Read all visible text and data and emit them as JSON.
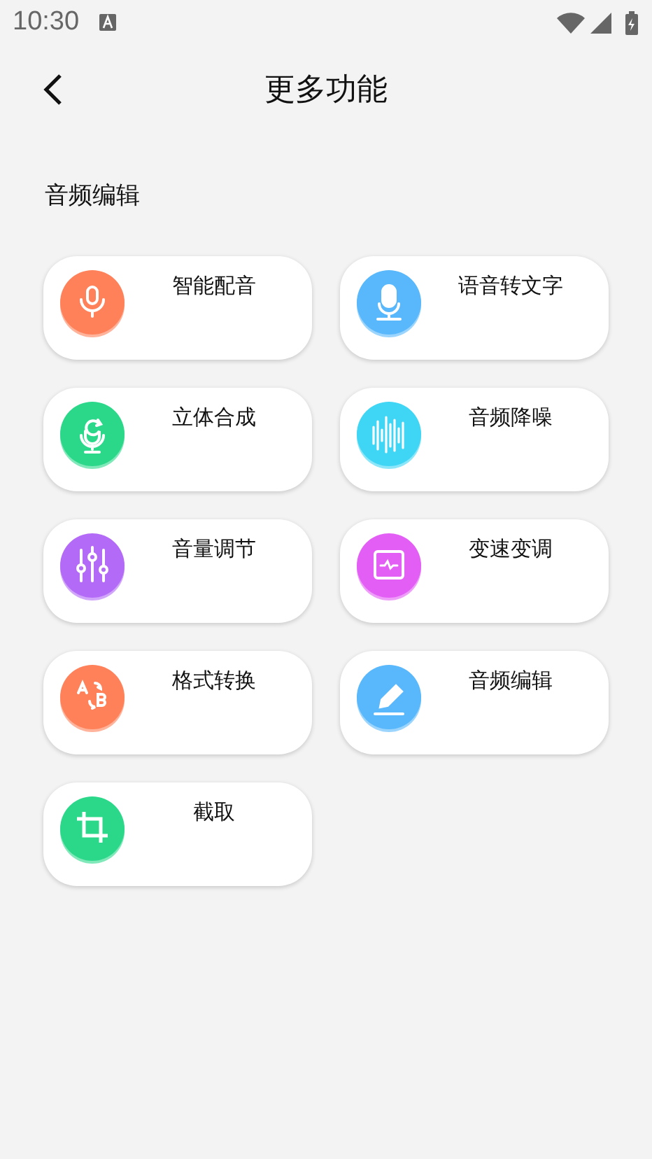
{
  "status_bar": {
    "time": "10:30"
  },
  "header": {
    "title": "更多功能"
  },
  "section": {
    "title": "音频编辑"
  },
  "features": [
    {
      "label": "智能配音",
      "kind": "mic",
      "color": "#ff8159"
    },
    {
      "label": "语音转文字",
      "kind": "mic-text",
      "color": "#58b8fb"
    },
    {
      "label": "立体合成",
      "kind": "mic-loop",
      "color": "#2bd88a"
    },
    {
      "label": "音频降噪",
      "kind": "wave",
      "color": "#3fd6f5"
    },
    {
      "label": "音量调节",
      "kind": "sliders",
      "color": "#b36bf7"
    },
    {
      "label": "变速变调",
      "kind": "monitor",
      "color": "#e35ef5"
    },
    {
      "label": "格式转换",
      "kind": "convert",
      "color": "#ff8159"
    },
    {
      "label": "音频编辑",
      "kind": "pencil",
      "color": "#58b8fb"
    },
    {
      "label": "截取",
      "kind": "crop",
      "color": "#2bd88a"
    }
  ]
}
